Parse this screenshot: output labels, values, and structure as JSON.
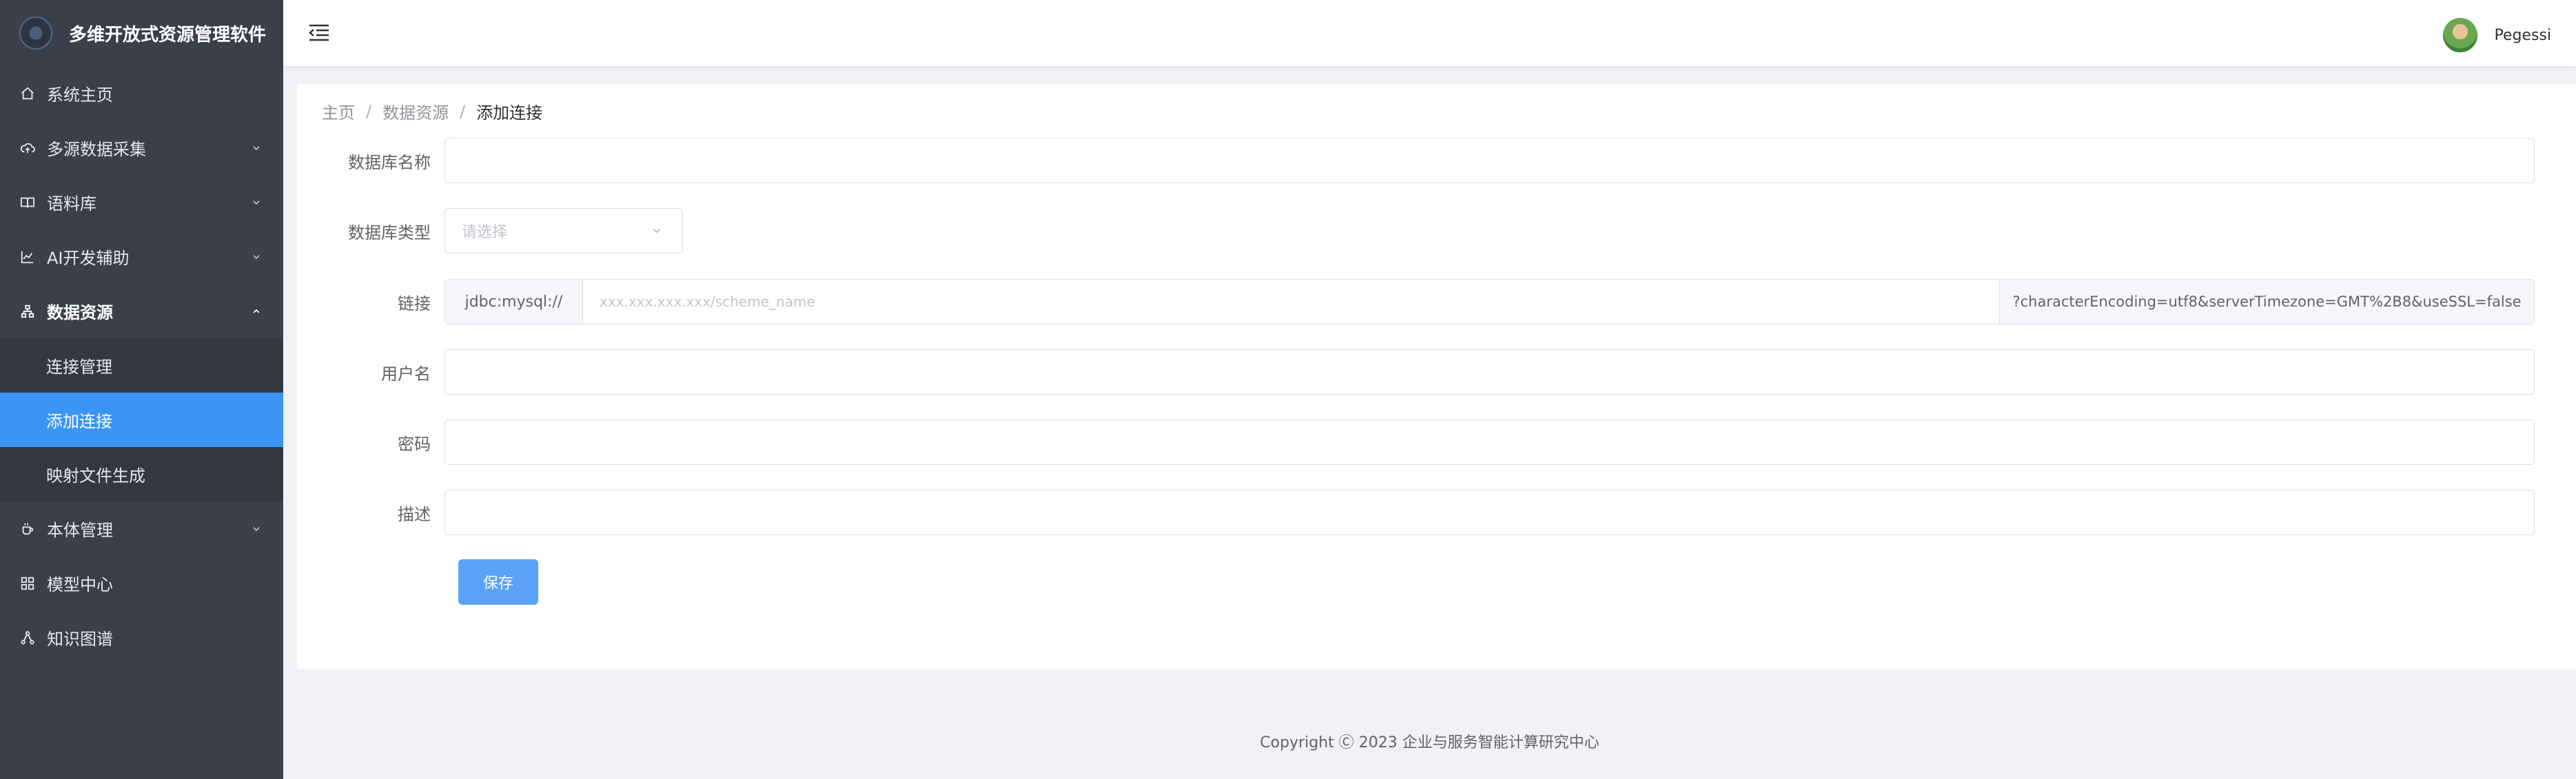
{
  "app": {
    "title": "多维开放式资源管理软件"
  },
  "sidebar": {
    "items": [
      {
        "label": "系统主页",
        "icon": "home-icon"
      },
      {
        "label": "多源数据采集",
        "icon": "cloud-upload-icon",
        "expandable": true
      },
      {
        "label": "语料库",
        "icon": "book-icon",
        "expandable": true
      },
      {
        "label": "AI开发辅助",
        "icon": "line-chart-icon",
        "expandable": true
      },
      {
        "label": "数据资源",
        "icon": "hierarchy-icon",
        "expandable": true,
        "open": true,
        "children": [
          {
            "label": "连接管理"
          },
          {
            "label": "添加连接",
            "active": true
          },
          {
            "label": "映射文件生成"
          }
        ]
      },
      {
        "label": "本体管理",
        "icon": "cup-icon",
        "expandable": true
      },
      {
        "label": "模型中心",
        "icon": "grid-icon"
      },
      {
        "label": "知识图谱",
        "icon": "graph-icon"
      }
    ]
  },
  "header": {
    "username": "Pegessi"
  },
  "breadcrumb": {
    "items": [
      "主页",
      "数据资源",
      "添加连接"
    ],
    "separator": "/"
  },
  "form": {
    "db_name": {
      "label": "数据库名称",
      "value": ""
    },
    "db_type": {
      "label": "数据库类型",
      "placeholder": "请选择"
    },
    "link": {
      "label": "链接",
      "prefix": "jdbc:mysql://",
      "placeholder": "xxx.xxx.xxx.xxx/scheme_name",
      "suffix": "?characterEncoding=utf8&serverTimezone=GMT%2B8&useSSL=false"
    },
    "username": {
      "label": "用户名",
      "value": ""
    },
    "password": {
      "label": "密码",
      "value": ""
    },
    "description": {
      "label": "描述",
      "value": ""
    },
    "save_label": "保存"
  },
  "footer": {
    "text": "Copyright Ⓒ 2023 企业与服务智能计算研究中心"
  },
  "colors": {
    "sidebar_bg": "#3a3f4a",
    "active_item": "#3b95f4",
    "primary_button": "#5aa2f7"
  }
}
